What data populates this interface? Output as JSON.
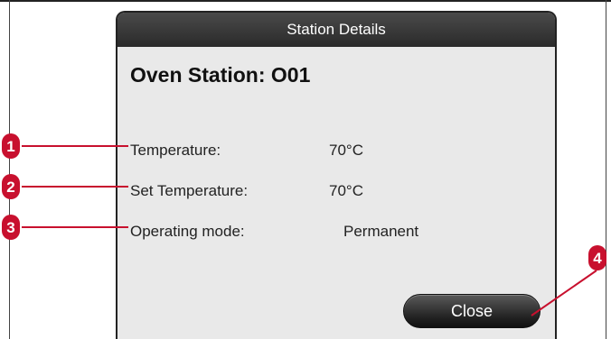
{
  "dialog": {
    "title": "Station Details",
    "heading": "Oven Station: O01",
    "rows": [
      {
        "label": "Temperature:",
        "value": "70°C"
      },
      {
        "label": "Set Temperature:",
        "value": "70°C"
      },
      {
        "label": "Operating mode:",
        "value": "Permanent"
      }
    ],
    "close_label": "Close"
  },
  "callouts": {
    "color": "#c8102e",
    "markers": [
      "1",
      "2",
      "3",
      "4"
    ]
  }
}
